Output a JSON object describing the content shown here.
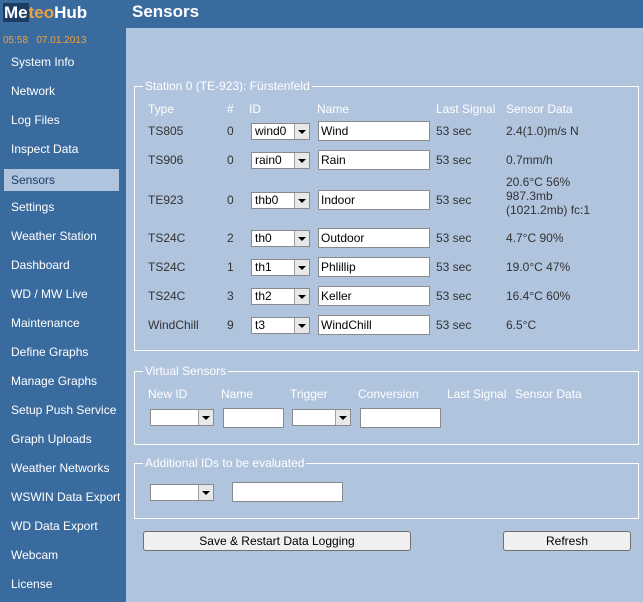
{
  "app": {
    "logo_me": "Me",
    "logo_teo": "teo",
    "logo_hub": "Hub",
    "time": "05:58",
    "date": "07.01.2013",
    "page_title": "Sensors"
  },
  "nav": [
    "System Info",
    "Network",
    "Log Files",
    "Inspect Data",
    "Sensors",
    "Settings",
    "Weather Station",
    "Dashboard",
    "WD / MW Live",
    "Maintenance",
    "Define Graphs",
    "Manage Graphs",
    "Setup Push Service",
    "Graph Uploads",
    "Weather Networks",
    "WSWIN Data Export",
    "WD Data Export",
    "Webcam",
    "License"
  ],
  "active_nav": "Sensors",
  "station": {
    "legend": "Station 0 (TE-923): Fürstenfeld",
    "headers": {
      "type": "Type",
      "num": "#",
      "id": "ID",
      "name": "Name",
      "last_signal": "Last Signal",
      "sensor_data": "Sensor Data"
    },
    "rows": [
      {
        "type": "TS805",
        "num": "0",
        "id": "wind0",
        "name": "Wind",
        "last_signal": "53 sec",
        "data": "2.4(1.0)m/s N"
      },
      {
        "type": "TS906",
        "num": "0",
        "id": "rain0",
        "name": "Rain",
        "last_signal": "53 sec",
        "data": "0.7mm/h"
      },
      {
        "type": "TE923",
        "num": "0",
        "id": "thb0",
        "name": "Indoor",
        "last_signal": "53 sec",
        "data": "20.6°C 56%",
        "data2": "987.3mb",
        "data3": "(1021.2mb) fc:1"
      },
      {
        "type": "TS24C",
        "num": "2",
        "id": "th0",
        "name": "Outdoor",
        "last_signal": "53 sec",
        "data": "4.7°C 90%"
      },
      {
        "type": "TS24C",
        "num": "1",
        "id": "th1",
        "name": "Phlillip",
        "last_signal": "53 sec",
        "data": "19.0°C 47%"
      },
      {
        "type": "TS24C",
        "num": "3",
        "id": "th2",
        "name": "Keller",
        "last_signal": "53 sec",
        "data": "16.4°C 60%"
      },
      {
        "type": "WindChill",
        "num": "9",
        "id": "t3",
        "name": "WindChill",
        "last_signal": "53 sec",
        "data": "6.5°C"
      }
    ]
  },
  "virtual": {
    "legend": "Virtual Sensors",
    "headers": {
      "new_id": "New ID",
      "name": "Name",
      "trigger": "Trigger",
      "conversion": "Conversion",
      "last_signal": "Last Signal",
      "sensor_data": "Sensor Data"
    },
    "new_id": "",
    "name": "",
    "trigger": "",
    "conversion": ""
  },
  "additional": {
    "legend": "Additional IDs to be evaluated",
    "id": "",
    "value": ""
  },
  "buttons": {
    "save": "Save & Restart Data Logging",
    "refresh": "Refresh"
  }
}
